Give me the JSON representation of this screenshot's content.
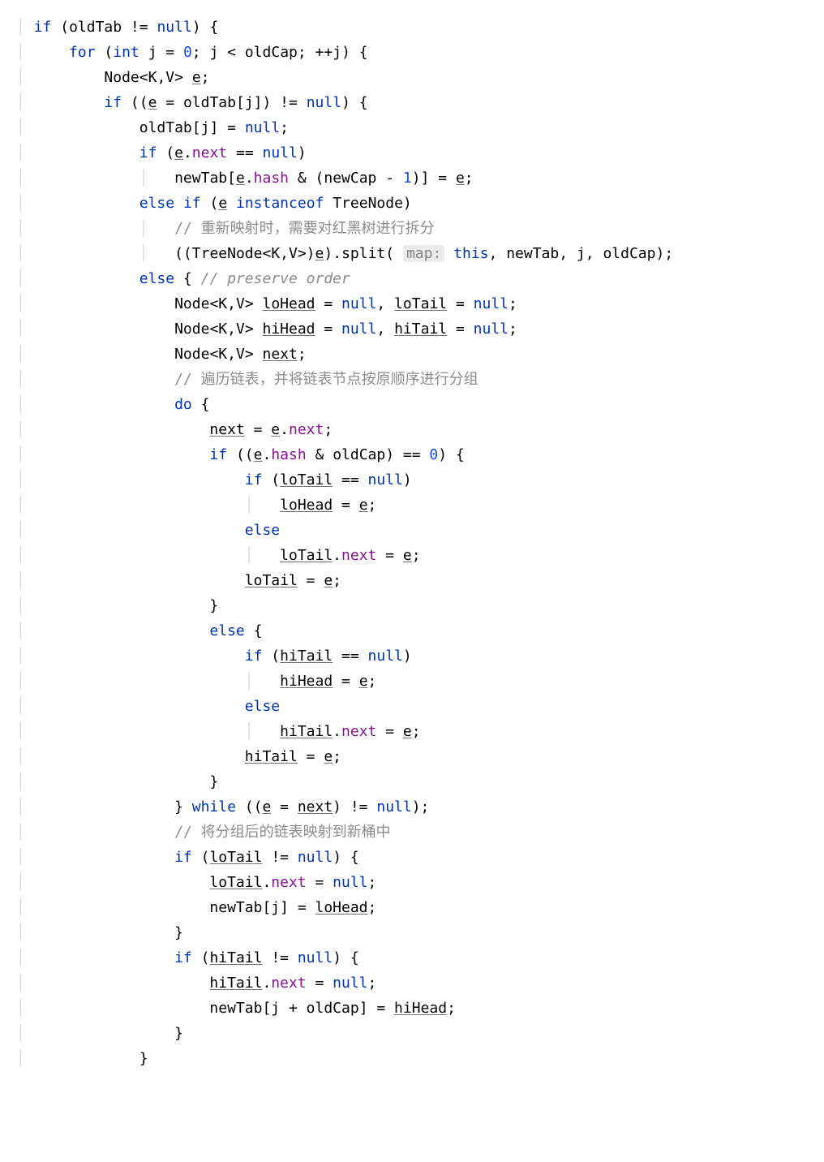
{
  "code": {
    "kw_if": "if",
    "kw_else": "else",
    "kw_for": "for",
    "kw_int": "int",
    "kw_null": "null",
    "kw_instanceof": "instanceof",
    "kw_do": "do",
    "kw_while": "while",
    "kw_this": "this",
    "num_0": "0",
    "num_1": "1",
    "id_oldTab": "oldTab",
    "id_j": "j",
    "id_oldCap": "oldCap",
    "id_newCap": "newCap",
    "id_Node": "Node",
    "id_K": "K",
    "id_V": "V",
    "id_e": "e",
    "id_newTab": "newTab",
    "fld_next": "next",
    "fld_hash": "hash",
    "id_TreeNode": "TreeNode",
    "id_split": "split",
    "hint_map": "map:",
    "id_loHead": "loHead",
    "id_loTail": "loTail",
    "id_hiHead": "hiHead",
    "id_hiTail": "hiTail",
    "id_next": "next",
    "cmt_tree": "// 重新映射时，需要对红黑树进行拆分",
    "cmt_preserve": "// preserve order",
    "cmt_iter": "// 遍历链表，并将链表节点按原顺序进行分组",
    "cmt_map": "// 将分组后的链表映射到新桶中"
  }
}
